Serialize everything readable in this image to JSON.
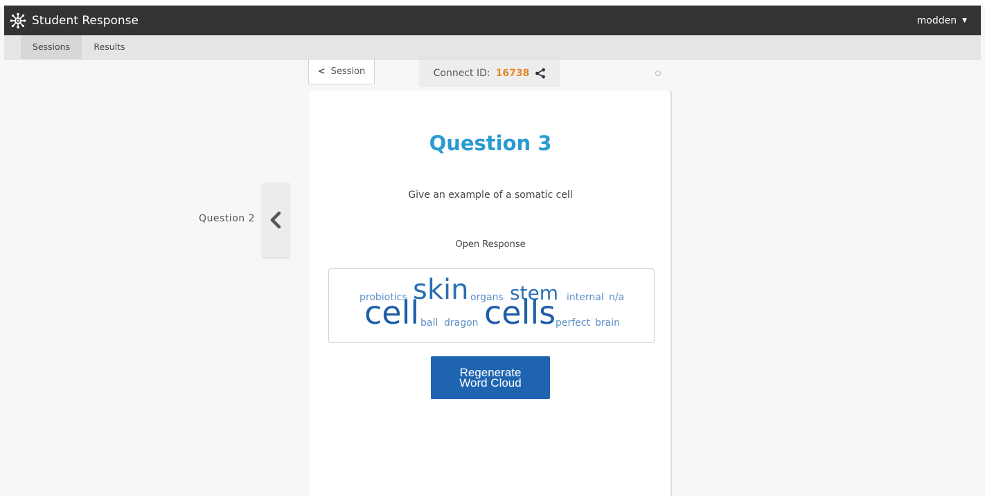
{
  "app": {
    "title": "Student Response"
  },
  "user_menu": {
    "username": "modden"
  },
  "subnav": {
    "tabs": [
      {
        "label": "Sessions",
        "active": true
      },
      {
        "label": "Results",
        "active": false
      }
    ]
  },
  "session_back": {
    "label": "Session"
  },
  "connect": {
    "label": "Connect ID:",
    "id": "16738"
  },
  "prev_question": {
    "label": "Question 2"
  },
  "question": {
    "title": "Question 3",
    "text": "Give an example of a somatic cell",
    "type": "Open Response"
  },
  "word_cloud": {
    "words": [
      {
        "text": "probiotics",
        "weight": "small",
        "color": "#5a8fc7"
      },
      {
        "text": "skin",
        "weight": "large",
        "color": "#2a6fb5"
      },
      {
        "text": "organs",
        "weight": "small",
        "color": "#5a8fc7"
      },
      {
        "text": "stem",
        "weight": "medium",
        "color": "#2a6fb5"
      },
      {
        "text": "internal",
        "weight": "small",
        "color": "#5a8fc7"
      },
      {
        "text": "n/a",
        "weight": "small",
        "color": "#5a8fc7"
      },
      {
        "text": "cell",
        "weight": "xlarge",
        "color": "#1f5ea8"
      },
      {
        "text": "ball",
        "weight": "small",
        "color": "#5a8fc7"
      },
      {
        "text": "dragon",
        "weight": "small",
        "color": "#5a8fc7"
      },
      {
        "text": "cells",
        "weight": "xlarge",
        "color": "#1f5ea8"
      },
      {
        "text": "perfect",
        "weight": "small",
        "color": "#5a8fc7"
      },
      {
        "text": "brain",
        "weight": "small",
        "color": "#5a8fc7"
      }
    ]
  },
  "regenerate": {
    "line1": "Regenerate",
    "line2": "Word Cloud"
  },
  "colors": {
    "accent": "#2a9bd1",
    "connect_id": "#e8862b",
    "button": "#1f64b0",
    "navbar": "#333333"
  }
}
